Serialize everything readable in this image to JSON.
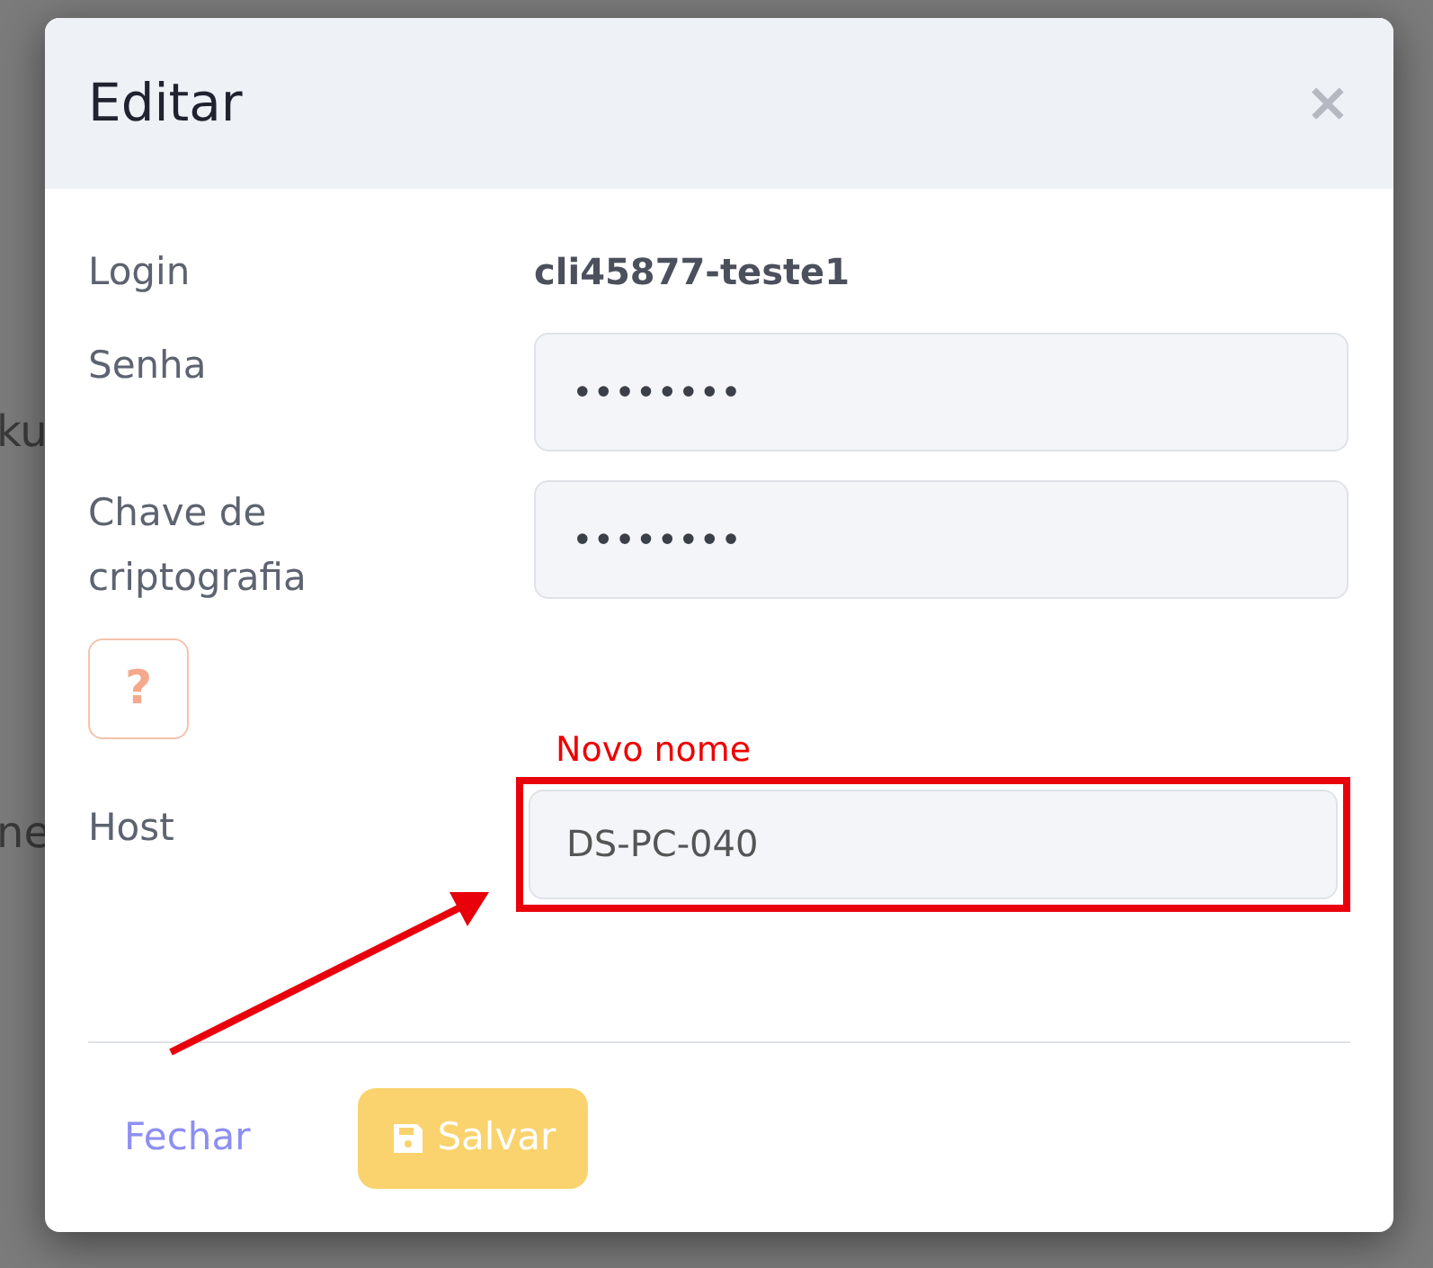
{
  "background": {
    "fragments": [
      "ku",
      "ne"
    ]
  },
  "modal": {
    "title": "Editar",
    "close": "×",
    "login": {
      "label": "Login",
      "value": "cli45877-teste1"
    },
    "fields": [
      {
        "label": "Senha",
        "value": "••••••••"
      },
      {
        "label": "Chave de criptografia",
        "value": "••••••••"
      }
    ],
    "help": "?",
    "host": {
      "label": "Host",
      "value": "DS-PC-040",
      "annotation": "Novo nome"
    },
    "footer": {
      "close": "Fechar",
      "save": "Salvar",
      "save_disabled": true
    }
  }
}
